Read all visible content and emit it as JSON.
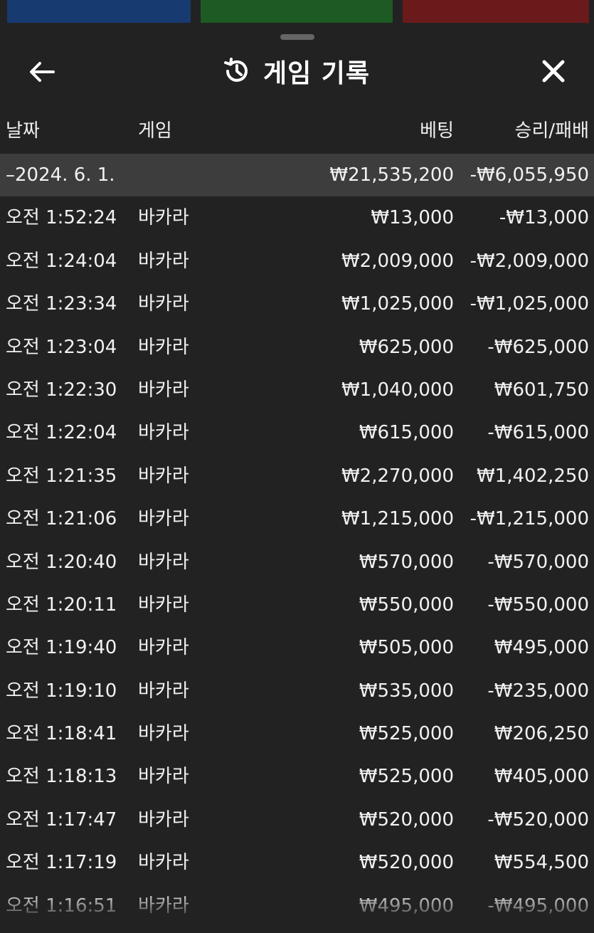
{
  "header": {
    "title": "게임 기록"
  },
  "columns": {
    "date": "날짜",
    "game": "게임",
    "bet": "베팅",
    "result": "승리/패배"
  },
  "summary": {
    "date": "–2024. 6. 1.",
    "bet": "₩21,535,200",
    "result": "-₩6,055,950"
  },
  "rows": [
    {
      "time": "오전 1:52:24",
      "game": "바카라",
      "bet": "₩13,000",
      "result": "-₩13,000"
    },
    {
      "time": "오전 1:24:04",
      "game": "바카라",
      "bet": "₩2,009,000",
      "result": "-₩2,009,000"
    },
    {
      "time": "오전 1:23:34",
      "game": "바카라",
      "bet": "₩1,025,000",
      "result": "-₩1,025,000"
    },
    {
      "time": "오전 1:23:04",
      "game": "바카라",
      "bet": "₩625,000",
      "result": "-₩625,000"
    },
    {
      "time": "오전 1:22:30",
      "game": "바카라",
      "bet": "₩1,040,000",
      "result": "₩601,750"
    },
    {
      "time": "오전 1:22:04",
      "game": "바카라",
      "bet": "₩615,000",
      "result": "-₩615,000"
    },
    {
      "time": "오전 1:21:35",
      "game": "바카라",
      "bet": "₩2,270,000",
      "result": "₩1,402,250"
    },
    {
      "time": "오전 1:21:06",
      "game": "바카라",
      "bet": "₩1,215,000",
      "result": "-₩1,215,000"
    },
    {
      "time": "오전 1:20:40",
      "game": "바카라",
      "bet": "₩570,000",
      "result": "-₩570,000"
    },
    {
      "time": "오전 1:20:11",
      "game": "바카라",
      "bet": "₩550,000",
      "result": "-₩550,000"
    },
    {
      "time": "오전 1:19:40",
      "game": "바카라",
      "bet": "₩505,000",
      "result": "₩495,000"
    },
    {
      "time": "오전 1:19:10",
      "game": "바카라",
      "bet": "₩535,000",
      "result": "-₩235,000"
    },
    {
      "time": "오전 1:18:41",
      "game": "바카라",
      "bet": "₩525,000",
      "result": "₩206,250"
    },
    {
      "time": "오전 1:18:13",
      "game": "바카라",
      "bet": "₩525,000",
      "result": "₩405,000"
    },
    {
      "time": "오전 1:17:47",
      "game": "바카라",
      "bet": "₩520,000",
      "result": "-₩520,000"
    },
    {
      "time": "오전 1:17:19",
      "game": "바카라",
      "bet": "₩520,000",
      "result": "₩554,500"
    },
    {
      "time": "오전 1:16:51",
      "game": "바카라",
      "bet": "₩495,000",
      "result": "-₩495,000"
    }
  ]
}
